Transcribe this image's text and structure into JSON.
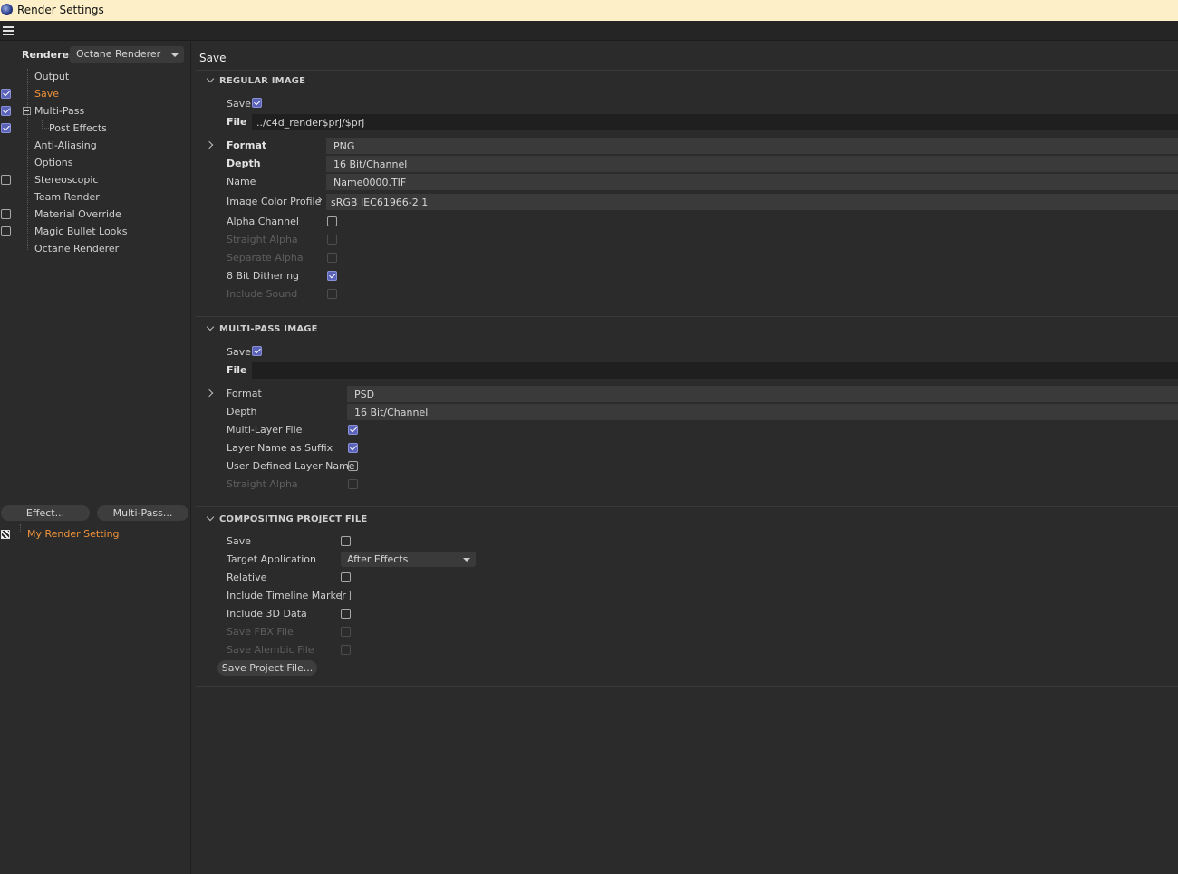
{
  "window": {
    "title": "Render Settings"
  },
  "sidebar": {
    "renderer_label": "Renderer",
    "renderer_value": "Octane Renderer",
    "items": [
      {
        "label": "Output"
      },
      {
        "label": "Save"
      },
      {
        "label": "Multi-Pass"
      },
      {
        "label": "Post Effects"
      },
      {
        "label": "Anti-Aliasing"
      },
      {
        "label": "Options"
      },
      {
        "label": "Stereoscopic"
      },
      {
        "label": "Team Render"
      },
      {
        "label": "Material Override"
      },
      {
        "label": "Magic Bullet Looks"
      },
      {
        "label": "Octane Renderer"
      }
    ],
    "effect_button": "Effect...",
    "multipass_button": "Multi-Pass...",
    "setting_name": "My Render Setting"
  },
  "panel": {
    "title": "Save",
    "regular": {
      "heading": "REGULAR IMAGE",
      "save_label": "Save",
      "file_label": "File",
      "file_value": "../c4d_render$prj/$prj",
      "format_label": "Format",
      "format_value": "PNG",
      "depth_label": "Depth",
      "depth_value": "16 Bit/Channel",
      "name_label": "Name",
      "name_value": "Name0000.TIF",
      "profile_label": "Image Color Profile",
      "profile_value": "sRGB IEC61966-2.1",
      "alpha_label": "Alpha Channel",
      "straight_alpha_label": "Straight Alpha",
      "separate_alpha_label": "Separate Alpha",
      "dithering_label": "8 Bit Dithering",
      "sound_label": "Include Sound"
    },
    "multipass": {
      "heading": "MULTI-PASS IMAGE",
      "save_label": "Save",
      "file_label": "File",
      "file_value": "",
      "format_label": "Format",
      "format_value": "PSD",
      "depth_label": "Depth",
      "depth_value": "16 Bit/Channel",
      "multilayer_label": "Multi-Layer File",
      "suffix_label": "Layer Name as Suffix",
      "userdefined_label": "User Defined Layer Name",
      "straight_alpha_label": "Straight Alpha"
    },
    "compositing": {
      "heading": "COMPOSITING PROJECT FILE",
      "save_label": "Save",
      "target_label": "Target Application",
      "target_value": "After Effects",
      "relative_label": "Relative",
      "timeline_label": "Include Timeline Marker",
      "data3d_label": "Include 3D Data",
      "fbx_label": "Save FBX File",
      "alembic_label": "Save Alembic File",
      "save_project_button": "Save Project File..."
    }
  },
  "colors": {
    "accent": "#f0923a",
    "checkbox": "#5b63b8",
    "titlebar": "#fdf0c8"
  }
}
